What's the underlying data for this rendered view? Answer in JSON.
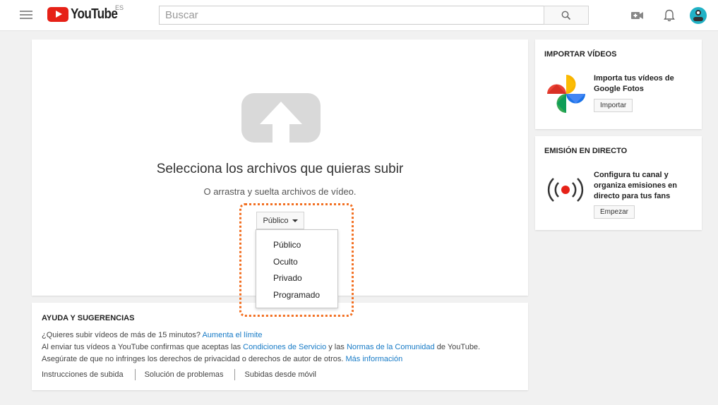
{
  "header": {
    "brand": "YouTube",
    "region": "ES",
    "search_placeholder": "Buscar"
  },
  "upload": {
    "title": "Selecciona los archivos que quieras subir",
    "subtitle": "O arrastra y suelta archivos de vídeo.",
    "privacy_selected": "Público",
    "privacy_options": [
      "Público",
      "Oculto",
      "Privado",
      "Programado"
    ]
  },
  "help": {
    "title": "AYUDA Y SUGERENCIAS",
    "line1_text": "¿Quieres subir vídeos de más de 15 minutos?",
    "line1_link": "Aumenta el límite",
    "line2_text_a": "Al enviar tus vídeos a YouTube confirmas que aceptas las",
    "line2_link_a": "Condiciones de Servicio",
    "line2_text_b": "y las",
    "line2_link_b": "Normas de la Comunidad",
    "line2_text_c": "de YouTube.",
    "line3_text": "Asegúrate de que no infringes los derechos de privacidad o derechos de autor de otros.",
    "line3_link": "Más información",
    "links": [
      "Instrucciones de subida",
      "Solución de problemas",
      "Subidas desde móvil"
    ]
  },
  "import_card": {
    "title": "IMPORTAR VÍDEOS",
    "text": "Importa tus vídeos de Google Fotos",
    "button": "Importar"
  },
  "live_card": {
    "title": "EMISIÓN EN DIRECTO",
    "text": "Configura tu canal y organiza emisiones en directo para tus fans",
    "button": "Empezar"
  },
  "colors": {
    "brand_red": "#e62117",
    "link_blue": "#167ac6",
    "highlight_orange": "#f26f21",
    "avatar_teal": "#21b2c6"
  },
  "icons": [
    "menu-icon",
    "youtube-logo-icon",
    "search-icon",
    "video-camera-icon",
    "bell-icon",
    "avatar",
    "upload-arrow-icon",
    "google-photos-icon",
    "live-broadcast-icon"
  ]
}
